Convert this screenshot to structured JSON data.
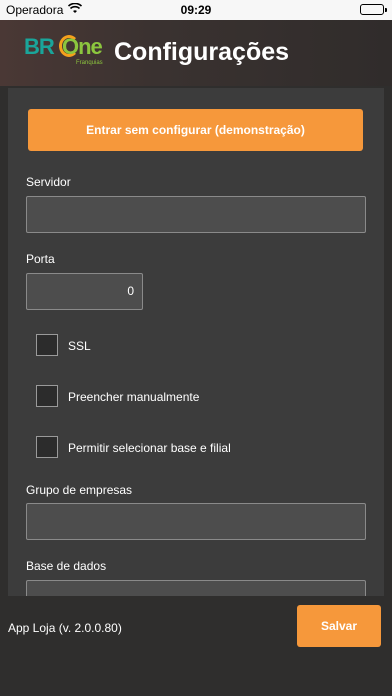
{
  "status_bar": {
    "carrier": "Operadora",
    "time": "09:29"
  },
  "header": {
    "logo_br": "BR",
    "logo_one": "One",
    "logo_sub": "Franquias",
    "title": "Configurações"
  },
  "form": {
    "demo_button": "Entrar sem configurar (demonstração)",
    "server_label": "Servidor",
    "server_value": "",
    "port_label": "Porta",
    "port_value": "0",
    "ssl_label": "SSL",
    "manual_label": "Preencher manualmente",
    "select_base_label": "Permitir selecionar base e filial",
    "company_group_label": "Grupo de empresas",
    "company_group_value": "",
    "database_label": "Base de dados",
    "database_value": ""
  },
  "footer": {
    "version": "App Loja (v. 2.0.0.80)",
    "save_button": "Salvar"
  },
  "colors": {
    "accent": "#f6983b",
    "background": "#2f2e2d",
    "panel": "#3c3c3c"
  }
}
